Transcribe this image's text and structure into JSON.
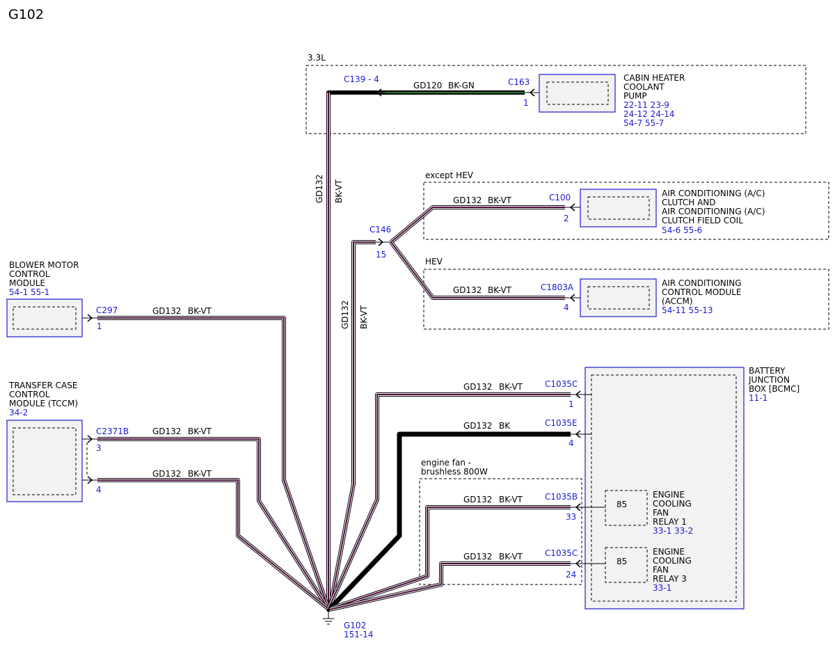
{
  "title": "G102",
  "regions": {
    "r33": "3.3L",
    "except_hev": "except HEV",
    "hev": "HEV",
    "engine_fan": [
      "engine fan -",
      "brushless 800W"
    ]
  },
  "connectors": {
    "c139": "C139 - 4",
    "c163": "C163",
    "c163_pin": "1",
    "c146": "C146",
    "c146_pin": "15",
    "c100": "C100",
    "c100_pin": "2",
    "c1803a": "C1803A",
    "c1803a_pin": "4",
    "c297": "C297",
    "c297_pin": "1",
    "c2371b": "C2371B",
    "c2371b_pin3": "3",
    "c2371b_pin4": "4",
    "c1035c_1": "C1035C",
    "c1035c_1_pin": "1",
    "c1035e": "C1035E",
    "c1035e_pin": "4",
    "c1035b": "C1035B",
    "c1035b_pin": "33",
    "c1035c_2": "C1035C",
    "c1035c_2_pin": "24"
  },
  "wires": {
    "gd120": "GD120",
    "bkgn": "BK-GN",
    "gd132": "GD132",
    "bkvt": "BK-VT",
    "bk": "BK"
  },
  "modules": {
    "cabin_heater": {
      "lines": [
        "CABIN HEATER",
        "COOLANT",
        "PUMP"
      ],
      "refs": [
        "22-11 23-9",
        "24-12 24-14",
        "54-7   55-7"
      ]
    },
    "ac_clutch": {
      "lines": [
        "AIR CONDITIONING (A/C)",
        "CLUTCH AND",
        "AIR CONDITIONING (A/C)",
        "CLUTCH FIELD COIL"
      ],
      "refs": [
        "54-6   55-6"
      ]
    },
    "accm": {
      "lines": [
        "AIR CONDITIONING",
        "CONTROL MODULE",
        "(ACCM)"
      ],
      "refs": [
        "54-11 55-13"
      ]
    },
    "blower": {
      "lines": [
        "BLOWER MOTOR",
        "CONTROL",
        "MODULE"
      ],
      "refs": [
        "54-1   55-1"
      ]
    },
    "tccm": {
      "lines": [
        "TRANSFER CASE",
        "CONTROL",
        "MODULE (TCCM)"
      ],
      "refs": [
        "34-2"
      ]
    },
    "bjb": {
      "lines": [
        "BATTERY",
        "JUNCTION",
        "BOX [BCMC]"
      ],
      "refs": [
        "11-1"
      ]
    },
    "relay1": {
      "pin": "85",
      "lines": [
        "ENGINE",
        "COOLING",
        "FAN",
        "RELAY 1"
      ],
      "refs": [
        "33-1   33-2"
      ]
    },
    "relay3": {
      "pin": "85",
      "lines": [
        "ENGINE",
        "COOLING",
        "FAN",
        "RELAY 3"
      ],
      "refs": [
        "33-1"
      ]
    }
  },
  "ground": {
    "label": "G102",
    "ref": "151-14"
  },
  "colors": {
    "blue": "#1a1ad6",
    "violet_core": "#4a0a3a",
    "green_core": "#2d7a2d"
  }
}
